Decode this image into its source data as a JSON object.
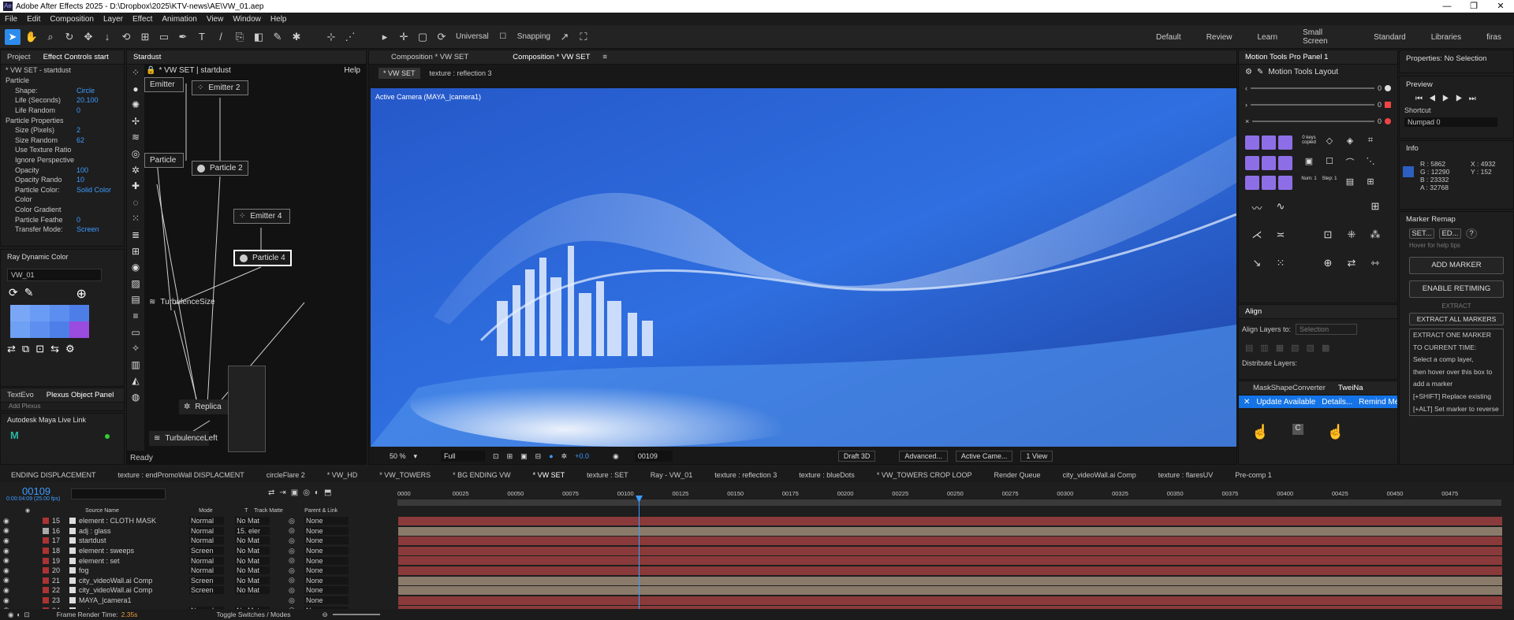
{
  "title": "Adobe After Effects 2025 - D:\\Dropbox\\2025\\KTV-news\\AE\\VW_01.aep",
  "menu": [
    "File",
    "Edit",
    "Composition",
    "Layer",
    "Effect",
    "Animation",
    "View",
    "Window",
    "Help"
  ],
  "toolbar": {
    "universal": "Universal",
    "snapping": "Snapping"
  },
  "workspaces": [
    "Default",
    "Review",
    "Learn",
    "Small Screen",
    "Standard",
    "Libraries",
    "firas"
  ],
  "project": {
    "tab1": "Project",
    "tab2": "Effect Controls start",
    "subtitle": "* VW SET - startdust",
    "rows": [
      {
        "l": "Particle",
        "v": ""
      },
      {
        "l": "Shape:",
        "v": "Circle"
      },
      {
        "l": "Life (Seconds)",
        "v": "20.100"
      },
      {
        "l": "Life Random",
        "v": "0"
      },
      {
        "l": "Particle Properties",
        "v": ""
      },
      {
        "l": "Size (Pixels)",
        "v": "2"
      },
      {
        "l": "Size Random",
        "v": "62"
      },
      {
        "l": "Use Texture Ratio",
        "v": ""
      },
      {
        "l": "Ignore Perspective",
        "v": ""
      },
      {
        "l": "Opacity",
        "v": "100"
      },
      {
        "l": "Opacity Rando",
        "v": "10"
      },
      {
        "l": "Particle Color:",
        "v": "Solid Color"
      },
      {
        "l": "Color",
        "v": ""
      },
      {
        "l": "Color Gradient",
        "v": ""
      },
      {
        "l": "Particle Feathe",
        "v": "0"
      },
      {
        "l": "Transfer Mode:",
        "v": "Screen"
      }
    ]
  },
  "ray": {
    "title": "Ray Dynamic Color",
    "select": "VW_01"
  },
  "textevo": {
    "tab1": "TextEvo",
    "tab2": "Plexus Object Panel",
    "item": "Add Plexus"
  },
  "maya": {
    "title": "Autodesk Maya Live Link"
  },
  "stardust": {
    "tab": "Stardust",
    "header": "* VW SET | startdust",
    "help": "Help",
    "ready": "Ready",
    "nodes": [
      "Emitter",
      "Emitter 2",
      "Particle",
      "Particle 2",
      "Emitter 4",
      "Particle 4",
      "TurbulenceSize",
      "Replica",
      "TurbulenceLeft"
    ]
  },
  "comp": {
    "tab1": "Composition * VW SET",
    "tab2": "Composition * VW SET",
    "sub1": "* VW SET",
    "sub2": "texture : reflection 3",
    "camera": "Active Camera (MAYA_|camera1)",
    "zoom": "50 %",
    "res": "Full",
    "frame": "00109",
    "plus": "+0.0",
    "draft": "Draft 3D",
    "adv": "Advanced...",
    "cam": "Active Came...",
    "view": "1 View"
  },
  "motion": {
    "tab": "Motion Tools Pro Panel 1",
    "layout": "Motion Tools Layout",
    "keys": "0 keys copied",
    "num": "Num: 1",
    "step": "Step: 1",
    "sliders": [
      "0",
      "0",
      "0"
    ]
  },
  "align": {
    "tab": "Align",
    "label": "Align Layers to:",
    "sel": "Selection",
    "dist": "Distribute Layers:"
  },
  "mask": {
    "tab1": "MaskShapeConverter",
    "tab2": "TweiNa",
    "update": "Update Available",
    "details": "Details...",
    "remind": "Remind Me"
  },
  "props": {
    "title": "Properties: No Selection",
    "preview": "Preview",
    "shortcut": "Shortcut",
    "numpad": "Numpad 0",
    "info": "Info",
    "r": "R : 5862",
    "g": "G : 12290",
    "b": "B : 23332",
    "a": "A : 32768",
    "x": "X : 4932",
    "y": "Y : 152"
  },
  "marker": {
    "title": "Marker Remap",
    "set": "SET...",
    "ed": "ED...",
    "hover": "Hover for help tips",
    "add": "ADD MARKER",
    "retime": "ENABLE RETIMING",
    "extract": "EXTRACT",
    "extractall": "EXTRACT ALL MARKERS",
    "notes": [
      "EXTRACT ONE MARKER",
      "TO CURRENT TIME:",
      "Select a comp layer,",
      "then hover over this box to",
      "add a marker",
      "[+SHIFT] Replace existing",
      "[+ALT] Set marker to reverse"
    ]
  },
  "tltabs": [
    "ENDING DISPLACEMENT",
    "texture : endPromoWall DISPLACMENT",
    "circleFlare 2",
    "* VW_HD",
    "* VW_TOWERS",
    "* BG ENDING VW",
    "* VW SET",
    "texture : SET",
    "Ray - VW_01",
    "texture : reflection 3",
    "texture : blueDots",
    "* VW_TOWERS CROP LOOP",
    "Render Queue",
    "city_videoWall.ai Comp",
    "texture : flaresUV",
    "Pre-comp 1"
  ],
  "timeline": {
    "time": "00109",
    "fps": "0:00:04:09 (25.00 fps)",
    "cols": {
      "src": "Source Name",
      "mode": "Mode",
      "t": "T",
      "matte": "Track Matte",
      "parent": "Parent & Link"
    },
    "ruler": [
      "0000",
      "00025",
      "00050",
      "00075",
      "00100",
      "00125",
      "00150",
      "00175",
      "00200",
      "00225",
      "00250",
      "00275",
      "00300",
      "00325",
      "00350",
      "00375",
      "00400",
      "00425",
      "00450",
      "00475"
    ],
    "layers": [
      {
        "n": "15",
        "name": "element : CLOTH MASK",
        "mode": "Normal",
        "matte": "No Mat",
        "parent": "None",
        "c": "#a33"
      },
      {
        "n": "16",
        "name": "adj : glass",
        "mode": "Normal",
        "matte": "15. eler",
        "parent": "None",
        "c": "#aaa"
      },
      {
        "n": "17",
        "name": "startdust",
        "mode": "Normal",
        "matte": "No Mat",
        "parent": "None",
        "c": "#a33"
      },
      {
        "n": "18",
        "name": "element : sweeps",
        "mode": "Screen",
        "matte": "No Mat",
        "parent": "None",
        "c": "#a33"
      },
      {
        "n": "19",
        "name": "element : set",
        "mode": "Normal",
        "matte": "No Mat",
        "parent": "None",
        "c": "#a33"
      },
      {
        "n": "20",
        "name": "fog",
        "mode": "Normal",
        "matte": "No Mat",
        "parent": "None",
        "c": "#a33"
      },
      {
        "n": "21",
        "name": "city_videoWall.ai Comp",
        "mode": "Screen",
        "matte": "No Mat",
        "parent": "None",
        "c": "#a33"
      },
      {
        "n": "22",
        "name": "city_videoWall.ai Comp",
        "mode": "Screen",
        "matte": "No Mat",
        "parent": "None",
        "c": "#a33"
      },
      {
        "n": "23",
        "name": "MAYA_|camera1",
        "mode": "",
        "matte": "",
        "parent": "None",
        "c": "#a33"
      },
      {
        "n": "24",
        "name": "water",
        "mode": "Normal",
        "matte": "No Mat",
        "parent": "None",
        "c": "#a33"
      }
    ],
    "render": "Frame Render Time:",
    "rendertime": "2.35s",
    "toggle": "Toggle Switches / Modes"
  }
}
